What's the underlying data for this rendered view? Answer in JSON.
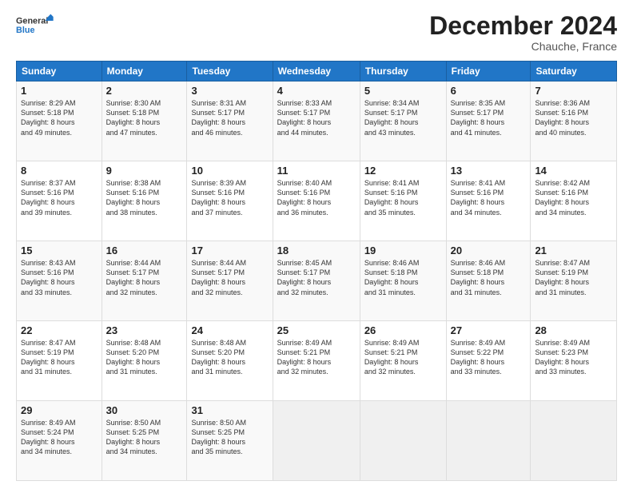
{
  "header": {
    "logo_line1": "General",
    "logo_line2": "Blue",
    "month": "December 2024",
    "location": "Chauche, France"
  },
  "days_header": [
    "Sunday",
    "Monday",
    "Tuesday",
    "Wednesday",
    "Thursday",
    "Friday",
    "Saturday"
  ],
  "weeks": [
    [
      {
        "day": "1",
        "lines": [
          "Sunrise: 8:29 AM",
          "Sunset: 5:18 PM",
          "Daylight: 8 hours",
          "and 49 minutes."
        ]
      },
      {
        "day": "2",
        "lines": [
          "Sunrise: 8:30 AM",
          "Sunset: 5:18 PM",
          "Daylight: 8 hours",
          "and 47 minutes."
        ]
      },
      {
        "day": "3",
        "lines": [
          "Sunrise: 8:31 AM",
          "Sunset: 5:17 PM",
          "Daylight: 8 hours",
          "and 46 minutes."
        ]
      },
      {
        "day": "4",
        "lines": [
          "Sunrise: 8:33 AM",
          "Sunset: 5:17 PM",
          "Daylight: 8 hours",
          "and 44 minutes."
        ]
      },
      {
        "day": "5",
        "lines": [
          "Sunrise: 8:34 AM",
          "Sunset: 5:17 PM",
          "Daylight: 8 hours",
          "and 43 minutes."
        ]
      },
      {
        "day": "6",
        "lines": [
          "Sunrise: 8:35 AM",
          "Sunset: 5:17 PM",
          "Daylight: 8 hours",
          "and 41 minutes."
        ]
      },
      {
        "day": "7",
        "lines": [
          "Sunrise: 8:36 AM",
          "Sunset: 5:16 PM",
          "Daylight: 8 hours",
          "and 40 minutes."
        ]
      }
    ],
    [
      {
        "day": "8",
        "lines": [
          "Sunrise: 8:37 AM",
          "Sunset: 5:16 PM",
          "Daylight: 8 hours",
          "and 39 minutes."
        ]
      },
      {
        "day": "9",
        "lines": [
          "Sunrise: 8:38 AM",
          "Sunset: 5:16 PM",
          "Daylight: 8 hours",
          "and 38 minutes."
        ]
      },
      {
        "day": "10",
        "lines": [
          "Sunrise: 8:39 AM",
          "Sunset: 5:16 PM",
          "Daylight: 8 hours",
          "and 37 minutes."
        ]
      },
      {
        "day": "11",
        "lines": [
          "Sunrise: 8:40 AM",
          "Sunset: 5:16 PM",
          "Daylight: 8 hours",
          "and 36 minutes."
        ]
      },
      {
        "day": "12",
        "lines": [
          "Sunrise: 8:41 AM",
          "Sunset: 5:16 PM",
          "Daylight: 8 hours",
          "and 35 minutes."
        ]
      },
      {
        "day": "13",
        "lines": [
          "Sunrise: 8:41 AM",
          "Sunset: 5:16 PM",
          "Daylight: 8 hours",
          "and 34 minutes."
        ]
      },
      {
        "day": "14",
        "lines": [
          "Sunrise: 8:42 AM",
          "Sunset: 5:16 PM",
          "Daylight: 8 hours",
          "and 34 minutes."
        ]
      }
    ],
    [
      {
        "day": "15",
        "lines": [
          "Sunrise: 8:43 AM",
          "Sunset: 5:16 PM",
          "Daylight: 8 hours",
          "and 33 minutes."
        ]
      },
      {
        "day": "16",
        "lines": [
          "Sunrise: 8:44 AM",
          "Sunset: 5:17 PM",
          "Daylight: 8 hours",
          "and 32 minutes."
        ]
      },
      {
        "day": "17",
        "lines": [
          "Sunrise: 8:44 AM",
          "Sunset: 5:17 PM",
          "Daylight: 8 hours",
          "and 32 minutes."
        ]
      },
      {
        "day": "18",
        "lines": [
          "Sunrise: 8:45 AM",
          "Sunset: 5:17 PM",
          "Daylight: 8 hours",
          "and 32 minutes."
        ]
      },
      {
        "day": "19",
        "lines": [
          "Sunrise: 8:46 AM",
          "Sunset: 5:18 PM",
          "Daylight: 8 hours",
          "and 31 minutes."
        ]
      },
      {
        "day": "20",
        "lines": [
          "Sunrise: 8:46 AM",
          "Sunset: 5:18 PM",
          "Daylight: 8 hours",
          "and 31 minutes."
        ]
      },
      {
        "day": "21",
        "lines": [
          "Sunrise: 8:47 AM",
          "Sunset: 5:19 PM",
          "Daylight: 8 hours",
          "and 31 minutes."
        ]
      }
    ],
    [
      {
        "day": "22",
        "lines": [
          "Sunrise: 8:47 AM",
          "Sunset: 5:19 PM",
          "Daylight: 8 hours",
          "and 31 minutes."
        ]
      },
      {
        "day": "23",
        "lines": [
          "Sunrise: 8:48 AM",
          "Sunset: 5:20 PM",
          "Daylight: 8 hours",
          "and 31 minutes."
        ]
      },
      {
        "day": "24",
        "lines": [
          "Sunrise: 8:48 AM",
          "Sunset: 5:20 PM",
          "Daylight: 8 hours",
          "and 31 minutes."
        ]
      },
      {
        "day": "25",
        "lines": [
          "Sunrise: 8:49 AM",
          "Sunset: 5:21 PM",
          "Daylight: 8 hours",
          "and 32 minutes."
        ]
      },
      {
        "day": "26",
        "lines": [
          "Sunrise: 8:49 AM",
          "Sunset: 5:21 PM",
          "Daylight: 8 hours",
          "and 32 minutes."
        ]
      },
      {
        "day": "27",
        "lines": [
          "Sunrise: 8:49 AM",
          "Sunset: 5:22 PM",
          "Daylight: 8 hours",
          "and 33 minutes."
        ]
      },
      {
        "day": "28",
        "lines": [
          "Sunrise: 8:49 AM",
          "Sunset: 5:23 PM",
          "Daylight: 8 hours",
          "and 33 minutes."
        ]
      }
    ],
    [
      {
        "day": "29",
        "lines": [
          "Sunrise: 8:49 AM",
          "Sunset: 5:24 PM",
          "Daylight: 8 hours",
          "and 34 minutes."
        ]
      },
      {
        "day": "30",
        "lines": [
          "Sunrise: 8:50 AM",
          "Sunset: 5:25 PM",
          "Daylight: 8 hours",
          "and 34 minutes."
        ]
      },
      {
        "day": "31",
        "lines": [
          "Sunrise: 8:50 AM",
          "Sunset: 5:25 PM",
          "Daylight: 8 hours",
          "and 35 minutes."
        ]
      },
      null,
      null,
      null,
      null
    ]
  ]
}
